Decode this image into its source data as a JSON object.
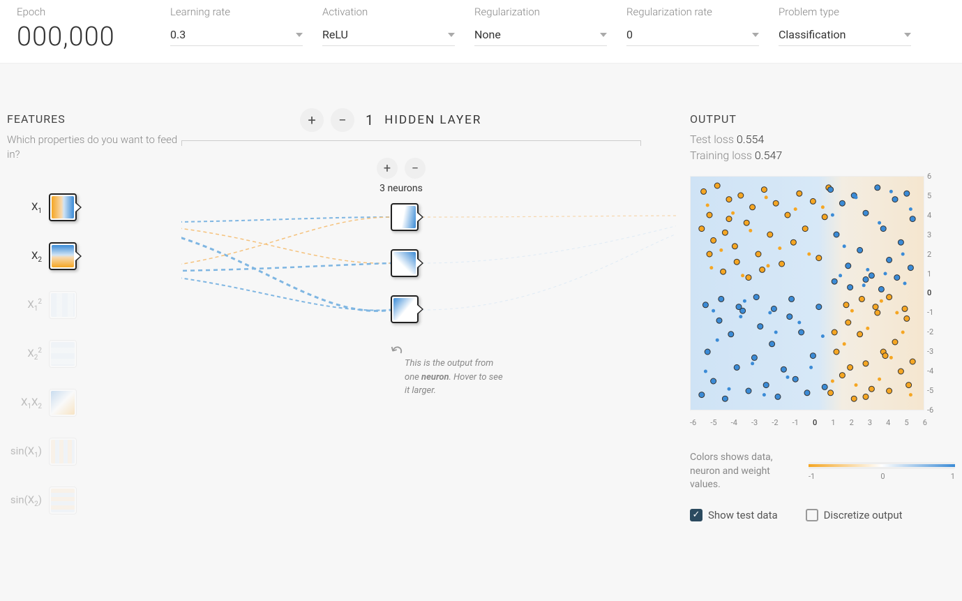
{
  "top": {
    "epoch_label": "Epoch",
    "epoch_value": "000,000",
    "learning_rate_label": "Learning rate",
    "learning_rate_value": "0.3",
    "activation_label": "Activation",
    "activation_value": "ReLU",
    "regularization_label": "Regularization",
    "regularization_value": "None",
    "regularization_rate_label": "Regularization rate",
    "regularization_rate_value": "0",
    "problem_type_label": "Problem type",
    "problem_type_value": "Classification"
  },
  "features": {
    "title": "FEATURES",
    "subtitle": "Which properties do you want to feed in?",
    "items": [
      {
        "id": "x1",
        "label_html": "X<sub>1</sub>",
        "active": true
      },
      {
        "id": "x2",
        "label_html": "X<sub>2</sub>",
        "active": true
      },
      {
        "id": "x1sq",
        "label_html": "X<sub>1</sub><sup>2</sup>",
        "active": false
      },
      {
        "id": "x2sq",
        "label_html": "X<sub>2</sub><sup>2</sup>",
        "active": false
      },
      {
        "id": "x1x2",
        "label_html": "X<sub>1</sub>X<sub>2</sub>",
        "active": false
      },
      {
        "id": "sinx1",
        "label_html": "sin(X<sub>1</sub>)",
        "active": false
      },
      {
        "id": "sinx2",
        "label_html": "sin(X<sub>2</sub>)",
        "active": false
      }
    ]
  },
  "network": {
    "hidden_layers": 1,
    "hidden_layers_label": "HIDDEN LAYER",
    "layer_neurons": 3,
    "neurons_label": "3 neurons",
    "callout": "This is the output from one neuron. Hover to see it larger.",
    "callout_bold": "neuron"
  },
  "output": {
    "title": "OUTPUT",
    "test_loss_label": "Test loss",
    "test_loss_value": "0.554",
    "training_loss_label": "Training loss",
    "training_loss_value": "0.547",
    "y_ticks": [
      "6",
      "5",
      "4",
      "3",
      "2",
      "1",
      "0",
      "-1",
      "-2",
      "-3",
      "-4",
      "-5",
      "-6"
    ],
    "x_ticks": [
      "-6",
      "-5",
      "-4",
      "-3",
      "-2",
      "-1",
      "0",
      "1",
      "2",
      "3",
      "4",
      "5",
      "6"
    ],
    "legend_text": "Colors shows data, neuron and weight values.",
    "legend_ticks": [
      "-1",
      "0",
      "1"
    ],
    "show_test_data_label": "Show test data",
    "show_test_data_checked": true,
    "discretize_label": "Discretize output",
    "discretize_checked": false
  },
  "chart_data": {
    "type": "scatter",
    "title": "",
    "xlabel": "",
    "ylabel": "",
    "xlim": [
      -6,
      6
    ],
    "ylim": [
      -6,
      6
    ],
    "background_regions": [
      {
        "color": "#cfe3f5",
        "x_range": [
          -6,
          1.5
        ]
      },
      {
        "color": "#f5e6cf",
        "x_range": [
          1.5,
          6
        ]
      }
    ],
    "series": [
      {
        "name": "class_orange_train",
        "color": "#f5a623",
        "stroke": "#333",
        "marker": "o",
        "size": 8,
        "points": [
          [
            -5.3,
            5.2
          ],
          [
            -5.0,
            4.0
          ],
          [
            -4.6,
            5.5
          ],
          [
            -4.2,
            3.1
          ],
          [
            -4.0,
            4.8
          ],
          [
            -3.7,
            2.4
          ],
          [
            -3.4,
            5.0
          ],
          [
            -3.1,
            3.6
          ],
          [
            -2.8,
            4.4
          ],
          [
            -2.5,
            2.0
          ],
          [
            -2.2,
            5.3
          ],
          [
            -1.9,
            3.0
          ],
          [
            -1.6,
            4.6
          ],
          [
            -1.3,
            1.5
          ],
          [
            -1.0,
            4.0
          ],
          [
            -0.7,
            2.6
          ],
          [
            -0.4,
            5.1
          ],
          [
            -0.1,
            3.3
          ],
          [
            0.3,
            4.7
          ],
          [
            0.6,
            1.8
          ],
          [
            0.9,
            3.9
          ],
          [
            1.1,
            5.4
          ],
          [
            -5.0,
            2.0
          ],
          [
            -4.3,
            1.1
          ],
          [
            -3.6,
            1.6
          ],
          [
            -3.0,
            0.8
          ],
          [
            -2.3,
            1.2
          ],
          [
            -5.4,
            3.3
          ],
          [
            -4.8,
            2.7
          ],
          [
            -4.0,
            3.8
          ],
          [
            1.2,
            -5.1
          ],
          [
            1.5,
            -3.0
          ],
          [
            1.8,
            -4.2
          ],
          [
            2.1,
            -1.5
          ],
          [
            2.4,
            -5.4
          ],
          [
            2.7,
            -2.1
          ],
          [
            3.0,
            -3.6
          ],
          [
            3.3,
            -4.9
          ],
          [
            3.6,
            -1.0
          ],
          [
            3.9,
            -3.0
          ],
          [
            4.2,
            -5.0
          ],
          [
            4.5,
            -2.5
          ],
          [
            4.8,
            -4.0
          ],
          [
            5.1,
            -1.3
          ],
          [
            5.4,
            -3.5
          ],
          [
            2.0,
            -0.6
          ],
          [
            2.8,
            -0.3
          ],
          [
            3.5,
            -0.7
          ],
          [
            4.2,
            -0.2
          ],
          [
            5.0,
            -0.8
          ],
          [
            1.4,
            -2.0
          ],
          [
            2.2,
            -3.8
          ],
          [
            3.0,
            -5.3
          ],
          [
            4.0,
            -3.2
          ],
          [
            5.2,
            -4.7
          ]
        ]
      },
      {
        "name": "class_orange_test",
        "color": "#f5a623",
        "stroke": "none",
        "marker": "o",
        "size": 5,
        "points": [
          [
            -5.1,
            4.5
          ],
          [
            -4.4,
            2.2
          ],
          [
            -3.8,
            4.1
          ],
          [
            -2.9,
            3.2
          ],
          [
            -2.1,
            4.9
          ],
          [
            -1.4,
            2.3
          ],
          [
            -0.6,
            4.3
          ],
          [
            0.1,
            2.0
          ],
          [
            0.8,
            4.4
          ],
          [
            -4.9,
            1.3
          ],
          [
            -3.3,
            0.9
          ],
          [
            -2.0,
            1.4
          ],
          [
            1.3,
            -4.5
          ],
          [
            1.9,
            -2.6
          ],
          [
            2.5,
            -4.7
          ],
          [
            3.1,
            -1.8
          ],
          [
            3.7,
            -4.4
          ],
          [
            4.3,
            -3.3
          ],
          [
            4.9,
            -2.0
          ],
          [
            5.3,
            -5.2
          ],
          [
            2.3,
            -0.9
          ],
          [
            3.8,
            -0.4
          ],
          [
            4.6,
            -1.0
          ]
        ]
      },
      {
        "name": "class_blue_train",
        "color": "#3b8bd6",
        "stroke": "#333",
        "marker": "o",
        "size": 8,
        "points": [
          [
            1.2,
            5.3
          ],
          [
            1.5,
            3.0
          ],
          [
            1.8,
            4.6
          ],
          [
            2.1,
            1.4
          ],
          [
            2.4,
            5.0
          ],
          [
            2.7,
            2.2
          ],
          [
            3.0,
            4.1
          ],
          [
            3.3,
            0.9
          ],
          [
            3.6,
            5.4
          ],
          [
            3.9,
            3.3
          ],
          [
            4.2,
            1.7
          ],
          [
            4.5,
            4.8
          ],
          [
            4.8,
            2.6
          ],
          [
            5.1,
            5.1
          ],
          [
            5.4,
            3.8
          ],
          [
            1.4,
            0.6
          ],
          [
            2.2,
            0.3
          ],
          [
            3.0,
            0.7
          ],
          [
            3.8,
            0.2
          ],
          [
            4.6,
            0.8
          ],
          [
            5.3,
            1.3
          ],
          [
            -5.4,
            -5.2
          ],
          [
            -5.1,
            -3.0
          ],
          [
            -4.8,
            -4.5
          ],
          [
            -4.5,
            -1.4
          ],
          [
            -4.2,
            -5.4
          ],
          [
            -3.9,
            -2.1
          ],
          [
            -3.6,
            -3.8
          ],
          [
            -3.3,
            -0.9
          ],
          [
            -3.0,
            -5.0
          ],
          [
            -2.7,
            -3.3
          ],
          [
            -2.4,
            -1.7
          ],
          [
            -2.1,
            -4.7
          ],
          [
            -1.8,
            -2.6
          ],
          [
            -1.5,
            -5.3
          ],
          [
            -1.2,
            -3.9
          ],
          [
            -0.9,
            -1.2
          ],
          [
            -0.6,
            -4.4
          ],
          [
            -0.3,
            -2.0
          ],
          [
            0.0,
            -5.1
          ],
          [
            0.3,
            -3.2
          ],
          [
            0.6,
            -0.7
          ],
          [
            0.9,
            -4.8
          ],
          [
            -5.2,
            -0.6
          ],
          [
            -4.4,
            -0.3
          ],
          [
            -3.5,
            -0.7
          ],
          [
            -2.6,
            -0.2
          ],
          [
            -1.7,
            -0.8
          ],
          [
            -0.8,
            -0.3
          ]
        ]
      },
      {
        "name": "class_blue_test",
        "color": "#3b8bd6",
        "stroke": "none",
        "marker": "o",
        "size": 5,
        "points": [
          [
            1.3,
            4.0
          ],
          [
            1.9,
            2.4
          ],
          [
            2.5,
            4.9
          ],
          [
            3.1,
            1.2
          ],
          [
            3.7,
            3.6
          ],
          [
            4.3,
            5.2
          ],
          [
            4.9,
            2.0
          ],
          [
            5.3,
            4.3
          ],
          [
            1.7,
            0.9
          ],
          [
            2.9,
            0.4
          ],
          [
            4.0,
            1.0
          ],
          [
            5.0,
            0.5
          ],
          [
            -5.2,
            -4.0
          ],
          [
            -4.6,
            -2.4
          ],
          [
            -4.0,
            -4.9
          ],
          [
            -3.4,
            -1.2
          ],
          [
            -2.8,
            -3.6
          ],
          [
            -2.2,
            -5.2
          ],
          [
            -1.6,
            -2.0
          ],
          [
            -1.0,
            -4.3
          ],
          [
            -0.4,
            -1.5
          ],
          [
            0.2,
            -3.8
          ],
          [
            0.8,
            -2.2
          ],
          [
            -4.8,
            -0.9
          ],
          [
            -3.2,
            -0.4
          ],
          [
            -1.9,
            -1.0
          ]
        ]
      }
    ]
  }
}
